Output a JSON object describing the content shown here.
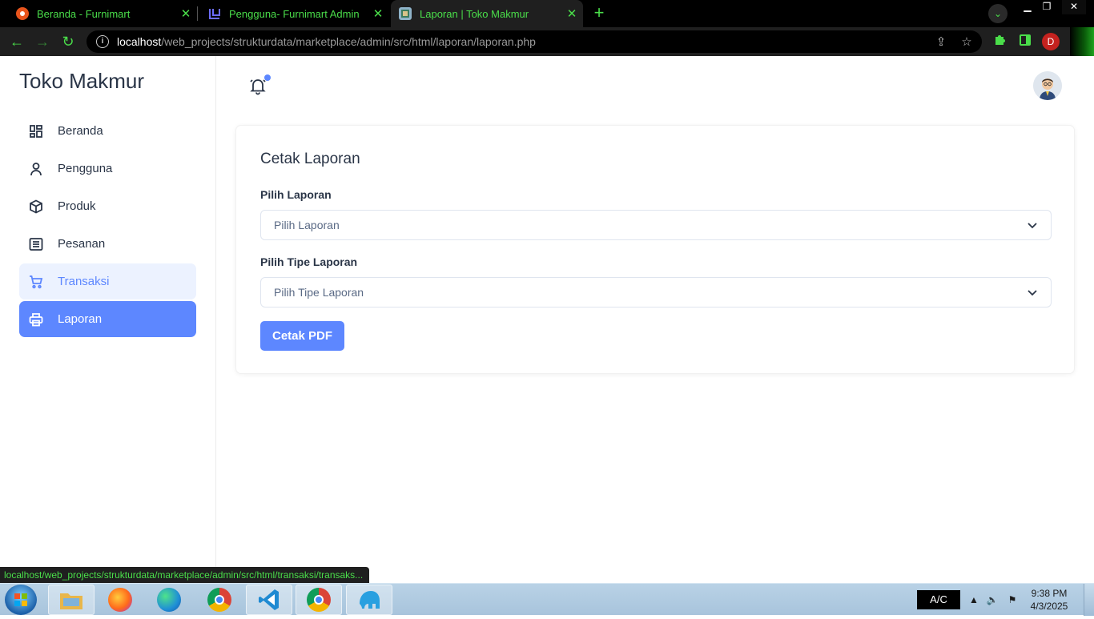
{
  "browser": {
    "tabs": [
      {
        "title": "Beranda - Furnimart",
        "icon": "furnimart-favicon"
      },
      {
        "title": "Pengguna- Furnimart Admin",
        "icon": "admin-favicon"
      },
      {
        "title": "Laporan | Toko Makmur",
        "icon": "toko-makmur-favicon"
      }
    ],
    "url_host": "localhost",
    "url_path": "/web_projects/strukturdata/marketplace/admin/src/html/laporan/laporan.php",
    "profile_initial": "D",
    "accent_color": "#4ade4a"
  },
  "sidebar": {
    "brand": "Toko Makmur",
    "items": [
      {
        "label": "Beranda",
        "icon": "dashboard-icon"
      },
      {
        "label": "Pengguna",
        "icon": "user-icon"
      },
      {
        "label": "Produk",
        "icon": "box-icon"
      },
      {
        "label": "Pesanan",
        "icon": "list-icon"
      },
      {
        "label": "Transaksi",
        "icon": "cart-icon",
        "state": "hover"
      },
      {
        "label": "Laporan",
        "icon": "printer-icon",
        "state": "active"
      }
    ]
  },
  "header": {
    "notification_icon": "bell-icon",
    "avatar": "user-avatar"
  },
  "report_form": {
    "title": "Cetak Laporan",
    "report_label": "Pilih Laporan",
    "report_placeholder": "Pilih Laporan",
    "type_label": "Pilih Tipe Laporan",
    "type_placeholder": "Pilih Tipe Laporan",
    "submit_label": "Cetak PDF"
  },
  "status_url": "localhost/web_projects/strukturdata/marketplace/admin/src/html/transaksi/transaks...",
  "taskbar": {
    "ac_label": "A/C",
    "time": "9:38 PM",
    "date": "4/3/2025"
  },
  "colors": {
    "primary": "#5d87ff",
    "primary_light": "#ecf2ff",
    "text": "#2a3547"
  }
}
